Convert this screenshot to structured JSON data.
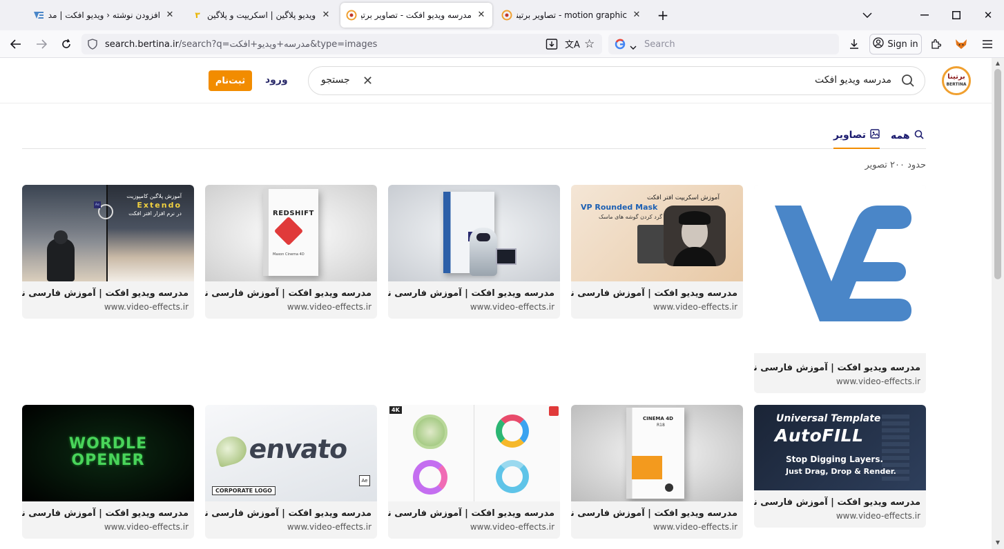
{
  "browser": {
    "tabs": [
      {
        "title": "افزودن نوشته ‹ ویدیو افکت | مدرسه",
        "active": false
      },
      {
        "title": "ویدیو پلاگین | اسکریپت و پلاگین",
        "active": false
      },
      {
        "title": "مدرسه ویدیو افکت - تصاویر برتینا",
        "active": true
      },
      {
        "title": "motion graphic - تصاویر برتینا | برتینا",
        "active": false
      }
    ],
    "url_prefix": "search.bertina.ir",
    "url_rest": "/search?q=مدرسه+ویدیو+افکت&type=images",
    "search_placeholder": "Search",
    "signin_label": "Sign in",
    "icons": [
      "back-icon",
      "forward-icon",
      "reload-icon",
      "shield-icon",
      "download-icon",
      "translate-icon",
      "star-icon",
      "google-icon",
      "account-icon",
      "extensions-icon",
      "fox-icon",
      "menu-icon"
    ]
  },
  "header": {
    "logo_text": "برتینا",
    "logo_sub": "BERTINA",
    "query": "مدرسه ویدیو افکت",
    "submit_label": "جستجو",
    "login_label": "ورود",
    "signup_label": "ثبت‌نام",
    "accent_color": "#f28c00"
  },
  "tabs": {
    "all_label": "همه",
    "images_label": "تصاویر"
  },
  "result_count": "حدود ۲۰۰ تصویر",
  "results": [
    {
      "title": "مدرسه ویدیو افکت | آموزش فارسی نرم...",
      "source": "www.video-effects.ir",
      "image": "VE logo"
    },
    {
      "title": "مدرسه ویدیو افکت | آموزش فارسی نرم...",
      "source": "www.video-effects.ir",
      "image": "VP Rounded Mask"
    },
    {
      "title": "مدرسه ویدیو افکت | آموزش فارسی نرم...",
      "source": "www.video-effects.ir",
      "image": "Video Effects box"
    },
    {
      "title": "مدرسه ویدیو افکت | آموزش فارسی نرم...",
      "source": "www.video-effects.ir",
      "image": "REDSHIFT box"
    },
    {
      "title": "مدرسه ویدیو افکت | آموزش فارسی نرم...",
      "source": "www.video-effects.ir",
      "image": "Extendo"
    },
    {
      "title": "مدرسه ویدیو افکت | آموزش فارسی نرم...",
      "source": "www.video-effects.ir",
      "image": "AutoFILL"
    },
    {
      "title": "مدرسه ویدیو افکت | آموزش فارسی نرم...",
      "source": "www.video-effects.ir",
      "image": "Cinema 4D box"
    },
    {
      "title": "مدرسه ویدیو افکت | آموزش فارسی نرم...",
      "source": "www.video-effects.ir",
      "image": "Glass logos"
    },
    {
      "title": "مدرسه ویدیو افکت | آموزش فارسی نرم...",
      "source": "www.video-effects.ir",
      "image": "envato"
    },
    {
      "title": "مدرسه ویدیو افکت | آموزش فارسی نرم...",
      "source": "www.video-effects.ir",
      "image": "WORDLE OPENER"
    }
  ],
  "image_text": {
    "vp_title": "VP Rounded Mask",
    "vp_fa1": "آموزش اسکریپت افتر افکت",
    "vp_fa2": "گرد کردن گوشه های ماسک",
    "redshift": "REDSHIFT",
    "maxon": "Maxon Cinema 4D",
    "extendo": "Extendo",
    "extendo_fa1": "آموزش پلاگین کامپوزیت",
    "extendo_fa2": "در نرم افزار افتر افکت",
    "autofill_1": "Universal Template",
    "autofill_2": "AutoFILL",
    "autofill_3": "Stop Digging Layers.",
    "autofill_4": "Just Drag, Drop & Render.",
    "c4d": "CINEMA 4D",
    "c4d_ver": "R18",
    "badge_4k": "4K",
    "envato": "envato",
    "corporate": "CORPORATE LOGO",
    "wordle_1": "WORDLE",
    "wordle_2": "OPENER",
    "ae": "Ae"
  }
}
